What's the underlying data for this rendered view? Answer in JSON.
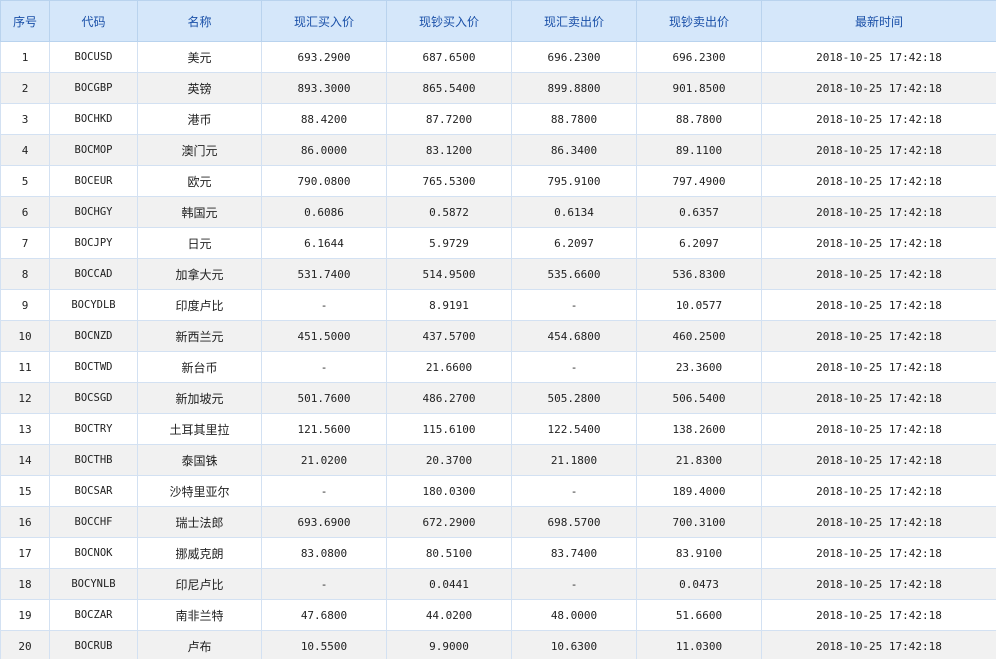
{
  "table": {
    "headers": [
      "序号",
      "代码",
      "名称",
      "现汇买入价",
      "现钞买入价",
      "现汇卖出价",
      "现钞卖出价",
      "最新时间"
    ],
    "rows": [
      {
        "seq": "1",
        "code": "BOCUSD",
        "name": "美元",
        "xh_buy": "693.2900",
        "xc_buy": "687.6500",
        "xh_sell": "696.2300",
        "xc_sell": "696.2300",
        "time": "2018-10-25 17:42:18"
      },
      {
        "seq": "2",
        "code": "BOCGBP",
        "name": "英镑",
        "xh_buy": "893.3000",
        "xc_buy": "865.5400",
        "xh_sell": "899.8800",
        "xc_sell": "901.8500",
        "time": "2018-10-25 17:42:18"
      },
      {
        "seq": "3",
        "code": "BOCHKD",
        "name": "港币",
        "xh_buy": "88.4200",
        "xc_buy": "87.7200",
        "xh_sell": "88.7800",
        "xc_sell": "88.7800",
        "time": "2018-10-25 17:42:18"
      },
      {
        "seq": "4",
        "code": "BOCMOP",
        "name": "澳门元",
        "xh_buy": "86.0000",
        "xc_buy": "83.1200",
        "xh_sell": "86.3400",
        "xc_sell": "89.1100",
        "time": "2018-10-25 17:42:18"
      },
      {
        "seq": "5",
        "code": "BOCEUR",
        "name": "欧元",
        "xh_buy": "790.0800",
        "xc_buy": "765.5300",
        "xh_sell": "795.9100",
        "xc_sell": "797.4900",
        "time": "2018-10-25 17:42:18"
      },
      {
        "seq": "6",
        "code": "BOCHGY",
        "name": "韩国元",
        "xh_buy": "0.6086",
        "xc_buy": "0.5872",
        "xh_sell": "0.6134",
        "xc_sell": "0.6357",
        "time": "2018-10-25 17:42:18"
      },
      {
        "seq": "7",
        "code": "BOCJPY",
        "name": "日元",
        "xh_buy": "6.1644",
        "xc_buy": "5.9729",
        "xh_sell": "6.2097",
        "xc_sell": "6.2097",
        "time": "2018-10-25 17:42:18"
      },
      {
        "seq": "8",
        "code": "BOCCAD",
        "name": "加拿大元",
        "xh_buy": "531.7400",
        "xc_buy": "514.9500",
        "xh_sell": "535.6600",
        "xc_sell": "536.8300",
        "time": "2018-10-25 17:42:18"
      },
      {
        "seq": "9",
        "code": "BOCYDLB",
        "name": "印度卢比",
        "xh_buy": "-",
        "xc_buy": "8.9191",
        "xh_sell": "-",
        "xc_sell": "10.0577",
        "time": "2018-10-25 17:42:18"
      },
      {
        "seq": "10",
        "code": "BOCNZD",
        "name": "新西兰元",
        "xh_buy": "451.5000",
        "xc_buy": "437.5700",
        "xh_sell": "454.6800",
        "xc_sell": "460.2500",
        "time": "2018-10-25 17:42:18"
      },
      {
        "seq": "11",
        "code": "BOCTWD",
        "name": "新台币",
        "xh_buy": "-",
        "xc_buy": "21.6600",
        "xh_sell": "-",
        "xc_sell": "23.3600",
        "time": "2018-10-25 17:42:18"
      },
      {
        "seq": "12",
        "code": "BOCSGD",
        "name": "新加坡元",
        "xh_buy": "501.7600",
        "xc_buy": "486.2700",
        "xh_sell": "505.2800",
        "xc_sell": "506.5400",
        "time": "2018-10-25 17:42:18"
      },
      {
        "seq": "13",
        "code": "BOCTRY",
        "name": "土耳其里拉",
        "xh_buy": "121.5600",
        "xc_buy": "115.6100",
        "xh_sell": "122.5400",
        "xc_sell": "138.2600",
        "time": "2018-10-25 17:42:18"
      },
      {
        "seq": "14",
        "code": "BOCTHB",
        "name": "泰国铢",
        "xh_buy": "21.0200",
        "xc_buy": "20.3700",
        "xh_sell": "21.1800",
        "xc_sell": "21.8300",
        "time": "2018-10-25 17:42:18"
      },
      {
        "seq": "15",
        "code": "BOCSAR",
        "name": "沙特里亚尔",
        "xh_buy": "-",
        "xc_buy": "180.0300",
        "xh_sell": "-",
        "xc_sell": "189.4000",
        "time": "2018-10-25 17:42:18"
      },
      {
        "seq": "16",
        "code": "BOCCHF",
        "name": "瑞士法郎",
        "xh_buy": "693.6900",
        "xc_buy": "672.2900",
        "xh_sell": "698.5700",
        "xc_sell": "700.3100",
        "time": "2018-10-25 17:42:18"
      },
      {
        "seq": "17",
        "code": "BOCNOK",
        "name": "挪威克朗",
        "xh_buy": "83.0800",
        "xc_buy": "80.5100",
        "xh_sell": "83.7400",
        "xc_sell": "83.9100",
        "time": "2018-10-25 17:42:18"
      },
      {
        "seq": "18",
        "code": "BOCYNLB",
        "name": "印尼卢比",
        "xh_buy": "-",
        "xc_buy": "0.0441",
        "xh_sell": "-",
        "xc_sell": "0.0473",
        "time": "2018-10-25 17:42:18"
      },
      {
        "seq": "19",
        "code": "BOCZAR",
        "name": "南非兰特",
        "xh_buy": "47.6800",
        "xc_buy": "44.0200",
        "xh_sell": "48.0000",
        "xc_sell": "51.6600",
        "time": "2018-10-25 17:42:18"
      },
      {
        "seq": "20",
        "code": "BOCRUB",
        "name": "卢布",
        "xh_buy": "10.5500",
        "xc_buy": "9.9000",
        "xh_sell": "10.6300",
        "xc_sell": "11.0300",
        "time": "2018-10-25 17:42:18"
      }
    ]
  },
  "colors": {
    "header_bg": "#d5e7fa",
    "header_text": "#1a50a8",
    "row_alt_bg": "#f1f1f1",
    "border": "#d3e1f2"
  }
}
